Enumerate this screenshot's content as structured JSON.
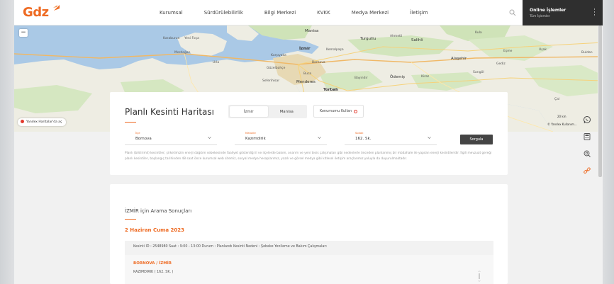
{
  "brand": {
    "logo_text": "Gdz",
    "accent": "#ee6a22"
  },
  "nav": {
    "items": [
      {
        "label": "Kurumsal"
      },
      {
        "label": "Sürdürülebilirlik"
      },
      {
        "label": "Bilgi Merkezi"
      },
      {
        "label": "KVKK"
      },
      {
        "label": "Medya Merkezi"
      },
      {
        "label": "İletişim"
      }
    ],
    "search_icon": "search-icon"
  },
  "online": {
    "title": "Online İşlemler",
    "subtitle": "Tüm İşlemler"
  },
  "map": {
    "zoom_out_label": "−",
    "yandex_link": "Yandex Haritalar'da aç",
    "scale_text": "20 km",
    "copyright": "© Yandex Kullanım...",
    "labels": [
      "Yeni Foça",
      "Manisa",
      "Turgutlu",
      "Ahmetli",
      "Salihli",
      "Kula",
      "Karşıyaka",
      "Kemalpaşa",
      "İzmir",
      "Bornova",
      "Buca",
      "Menderes",
      "Torbalı",
      "Bayındır",
      "Ödemiş",
      "Kiraz",
      "Alaşehir",
      "Eşme",
      "Uşak",
      "Sarıgöl",
      "Urla",
      "Seferihisar",
      "Güzelbahçe",
      "Karaburun",
      "Mordoğan",
      "Gediz",
      "Buldan",
      "Çal"
    ]
  },
  "search": {
    "title": "Planlı Kesinti Haritası",
    "tabs": [
      {
        "label": "İzmir",
        "active": true
      },
      {
        "label": "Manisa",
        "active": false
      }
    ],
    "location_button": "Konumumu Kullan",
    "fields": [
      {
        "label": "İlçe",
        "value": "Bornova"
      },
      {
        "label": "Mahalle",
        "value": "Kazımdirik"
      },
      {
        "label": "Sokak",
        "value": "162. Sk."
      }
    ],
    "query_button": "Sorgula",
    "description": "Planlı (bildirimli) kesintiler; şirketimizin enerji dağıtım sebekesinde faaliyet gösterdiği il ve ilçelerde bakım, onarım ve yeni tesis çalışmaları gibi nedenlerle önceden planlanmış bir müdahale ile yapılan enerji kesintileridir. İlgili mevzuat gereği planlı kesintiler, başlangıç tarihinden 48 saat önce kurumsal web sitemiz, sosyal medya hesaplarımız, yazılı ve görsel medya gibi kitlesel iletişim araçlarımız yoluyla da duyurulmaktadır."
  },
  "results": {
    "title": "İZMİR için Arama Sonuçları",
    "date": "2 Haziran Cuma 2023",
    "card": {
      "info": "Kesinti ID : 2548980   Saat : 9:00 - 13:00   Durum : Planlandı   Kesinti Nedeni : Şebeke Yenileme ve Bakım Çalışmaları",
      "location": "BORNOVA / İZMİR",
      "street": "KAZIMDIRIK ( 162. SK. )"
    }
  },
  "side_icons": [
    "whatsapp-icon",
    "calculator-icon",
    "search-document-icon",
    "link-icon"
  ]
}
